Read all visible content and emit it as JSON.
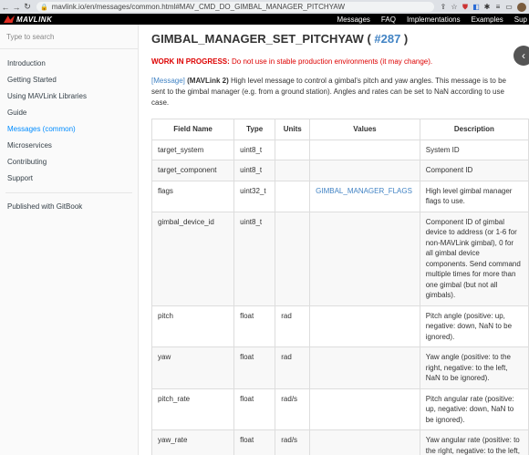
{
  "browser": {
    "url": "mavlink.io/en/messages/common.html#MAV_CMD_DO_GIMBAL_MANAGER_PITCHYAW"
  },
  "site": {
    "logo": "MAVLINK",
    "nav": [
      "Messages",
      "FAQ",
      "Implementations",
      "Examples",
      "Sup"
    ]
  },
  "sidebar": {
    "search_placeholder": "Type to search",
    "items": [
      "Introduction",
      "Getting Started",
      "Using MAVLink Libraries",
      "Guide",
      "Messages (common)",
      "Microservices",
      "Contributing",
      "Support"
    ],
    "active_index": 4,
    "footer": "Published with GitBook"
  },
  "main": {
    "title": "GIMBAL_MANAGER_SET_PITCHYAW ( ",
    "title_num": "#287",
    "title_end": " )",
    "wip_label": "WORK IN PROGRESS:",
    "wip_text": " Do not use in stable production environments (it may change).",
    "desc_tag": "[Message]",
    "desc_bold": " (MAVLink 2)",
    "desc_text": " High level message to control a gimbal's pitch and yaw angles. This message is to be sent to the gimbal manager (e.g. from a ground station). Angles and rates can be set to NaN according to use case.",
    "table": {
      "headers": [
        "Field Name",
        "Type",
        "Units",
        "Values",
        "Description"
      ],
      "rows": [
        [
          "target_system",
          "uint8_t",
          "",
          "",
          "System ID"
        ],
        [
          "target_component",
          "uint8_t",
          "",
          "",
          "Component ID"
        ],
        [
          "flags",
          "uint32_t",
          "",
          "GIMBAL_MANAGER_FLAGS",
          "High level gimbal manager flags to use."
        ],
        [
          "gimbal_device_id",
          "uint8_t",
          "",
          "",
          "Component ID of gimbal device to address (or 1-6 for non-MAVLink gimbal), 0 for all gimbal device components. Send command multiple times for more than one gimbal (but not all gimbals)."
        ],
        [
          "pitch",
          "float",
          "rad",
          "",
          "Pitch angle (positive: up, negative: down, NaN to be ignored)."
        ],
        [
          "yaw",
          "float",
          "rad",
          "",
          "Yaw angle (positive: to the right, negative: to the left, NaN to be ignored)."
        ],
        [
          "pitch_rate",
          "float",
          "rad/s",
          "",
          "Pitch angular rate (positive: up, negative: down, NaN to be ignored)."
        ],
        [
          "yaw_rate",
          "float",
          "rad/s",
          "",
          "Yaw angular rate (positive: to the right, negative: to the left, NaN"
        ]
      ]
    }
  }
}
